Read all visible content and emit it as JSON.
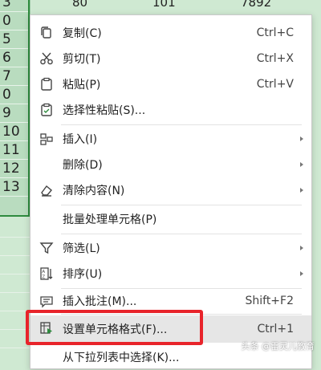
{
  "sheet": {
    "row_values": [
      "3",
      "0",
      "5",
      "6",
      "7",
      "0",
      "9",
      "10",
      "11",
      "12",
      "13"
    ],
    "top_cells": [
      "80",
      "101",
      "7892"
    ]
  },
  "menu": {
    "items": [
      {
        "label": "复制(C)",
        "shortcut": "Ctrl+C",
        "icon": "copy-icon"
      },
      {
        "label": "剪切(T)",
        "shortcut": "Ctrl+X",
        "icon": "scissors-icon"
      },
      {
        "label": "粘贴(P)",
        "shortcut": "Ctrl+V",
        "icon": "paste-icon"
      },
      {
        "label": "选择性粘贴(S)...",
        "shortcut": "",
        "icon": "paste-special-icon"
      },
      {
        "label": "插入(I)",
        "shortcut": "",
        "icon": "insert-icon"
      },
      {
        "label": "删除(D)",
        "shortcut": "",
        "icon": ""
      },
      {
        "label": "清除内容(N)",
        "shortcut": "",
        "icon": "eraser-icon"
      },
      {
        "label": "批量处理单元格(P)",
        "shortcut": "",
        "icon": ""
      },
      {
        "label": "筛选(L)",
        "shortcut": "",
        "icon": "filter-icon"
      },
      {
        "label": "排序(U)",
        "shortcut": "",
        "icon": "sort-icon"
      },
      {
        "label": "插入批注(M)...",
        "shortcut": "Shift+F2",
        "icon": "comment-icon"
      },
      {
        "label": "设置单元格格式(F)...",
        "shortcut": "Ctrl+1",
        "icon": "format-cells-icon"
      },
      {
        "label": "从下拉列表中选择(K)...",
        "shortcut": "",
        "icon": ""
      }
    ]
  },
  "watermark": "头条 @雷灵儿教育",
  "colors": {
    "highlight_box": "#e8242b",
    "selection": "#2e8b3e"
  }
}
